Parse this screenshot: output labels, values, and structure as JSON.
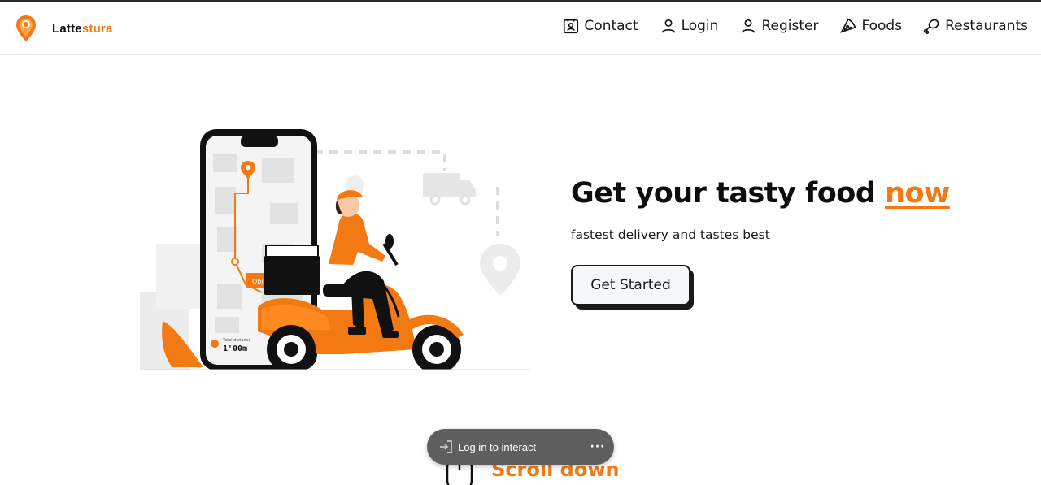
{
  "brand": {
    "name_part1": "Latte",
    "name_part2": "stura",
    "accent_color": "#f37a12"
  },
  "nav": {
    "items": [
      {
        "label": "Contact",
        "icon": "contact-badge-icon"
      },
      {
        "label": "Login",
        "icon": "user-icon"
      },
      {
        "label": "Register",
        "icon": "user-plus-icon"
      },
      {
        "label": "Foods",
        "icon": "pizza-slice-icon"
      },
      {
        "label": "Restaurants",
        "icon": "meat-icon"
      }
    ]
  },
  "hero": {
    "title_main": "Get your tasty food ",
    "title_accent": "now",
    "subtitle": "fastest delivery and tastes best",
    "cta_label": "Get Started",
    "illustration": {
      "phone_label": "Obj",
      "distance_caption": "Total distance",
      "distance_value": "1'00m"
    }
  },
  "scroll": {
    "label": "Scroll down"
  },
  "overlay": {
    "login_text": "Log in to interact",
    "more_glyph": "···"
  }
}
